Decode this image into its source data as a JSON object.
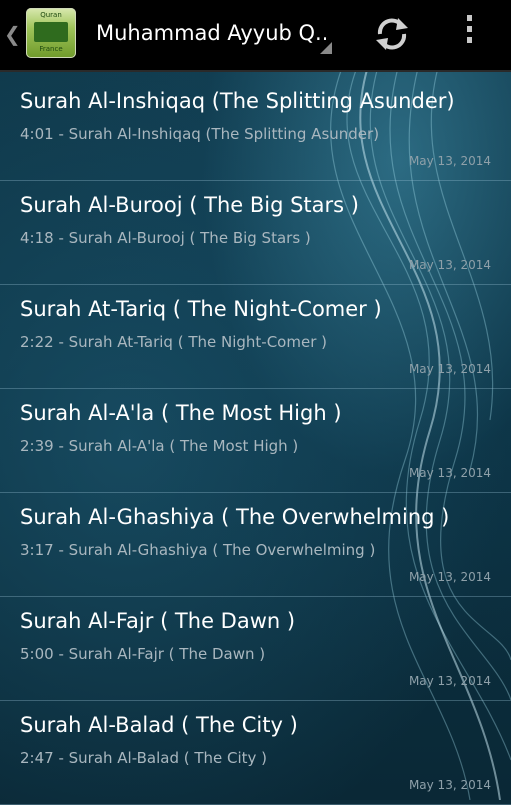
{
  "actionbar": {
    "title": "Muhammad Ayyub Q..",
    "app_icon_text_top": "Quran",
    "app_icon_text_bottom": "France"
  },
  "tracks": [
    {
      "name": "Surah Al-Inshiqaq (The Splitting Asunder)",
      "subtitle": "4:01 - Surah Al-Inshiqaq (The Splitting Asunder)",
      "date": "May 13, 2014"
    },
    {
      "name": "Surah Al-Burooj ( The Big Stars )",
      "subtitle": "4:18 - Surah Al-Burooj ( The Big Stars )",
      "date": "May 13, 2014"
    },
    {
      "name": "Surah At-Tariq ( The Night-Comer )",
      "subtitle": "2:22 - Surah At-Tariq ( The Night-Comer )",
      "date": "May 13, 2014"
    },
    {
      "name": "Surah Al-A'la ( The Most High )",
      "subtitle": "2:39 - Surah Al-A'la ( The Most High )",
      "date": "May 13, 2014"
    },
    {
      "name": "Surah Al-Ghashiya ( The Overwhelming )",
      "subtitle": "3:17 - Surah Al-Ghashiya ( The Overwhelming )",
      "date": "May 13, 2014"
    },
    {
      "name": "Surah Al-Fajr ( The Dawn )",
      "subtitle": "5:00 - Surah Al-Fajr ( The Dawn )",
      "date": "May 13, 2014"
    },
    {
      "name": "Surah Al-Balad ( The City )",
      "subtitle": "2:47 - Surah Al-Balad ( The City )",
      "date": "May 13, 2014"
    }
  ]
}
